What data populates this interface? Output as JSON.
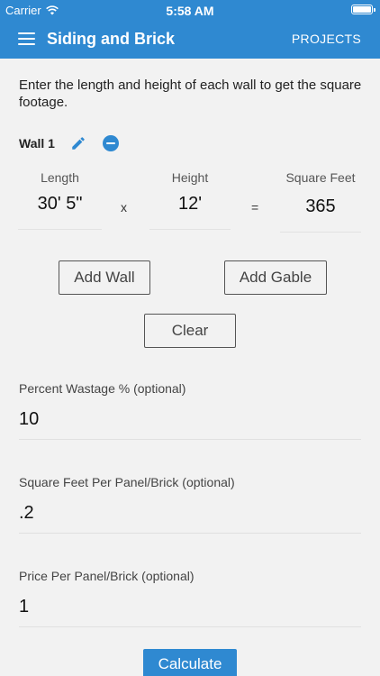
{
  "status": {
    "carrier": "Carrier",
    "time": "5:58 AM"
  },
  "header": {
    "title": "Siding and Brick",
    "action_label": "PROJECTS"
  },
  "intro": "Enter the length and height of each wall to get the square footage.",
  "wall": {
    "title": "Wall 1",
    "length_label": "Length",
    "height_label": "Height",
    "area_label": "Square Feet",
    "length_value": "30' 5\"",
    "height_value": "12'",
    "area_value": "365",
    "times_symbol": "x",
    "equals_symbol": "="
  },
  "buttons": {
    "add_wall": "Add Wall",
    "add_gable": "Add Gable",
    "clear": "Clear",
    "calculate": "Calculate"
  },
  "fields": [
    {
      "label": "Percent Wastage % (optional)",
      "value": "10"
    },
    {
      "label": "Square Feet Per Panel/Brick (optional)",
      "value": ".2"
    },
    {
      "label": "Price Per Panel/Brick (optional)",
      "value": "1"
    }
  ],
  "colors": {
    "primary": "#2f89d1",
    "background": "#f2f2f2"
  },
  "icons": {
    "menu": "hamburger-menu-icon",
    "edit": "pencil-icon",
    "remove": "minus-circle-icon",
    "wifi": "wifi-icon",
    "battery": "battery-icon"
  }
}
